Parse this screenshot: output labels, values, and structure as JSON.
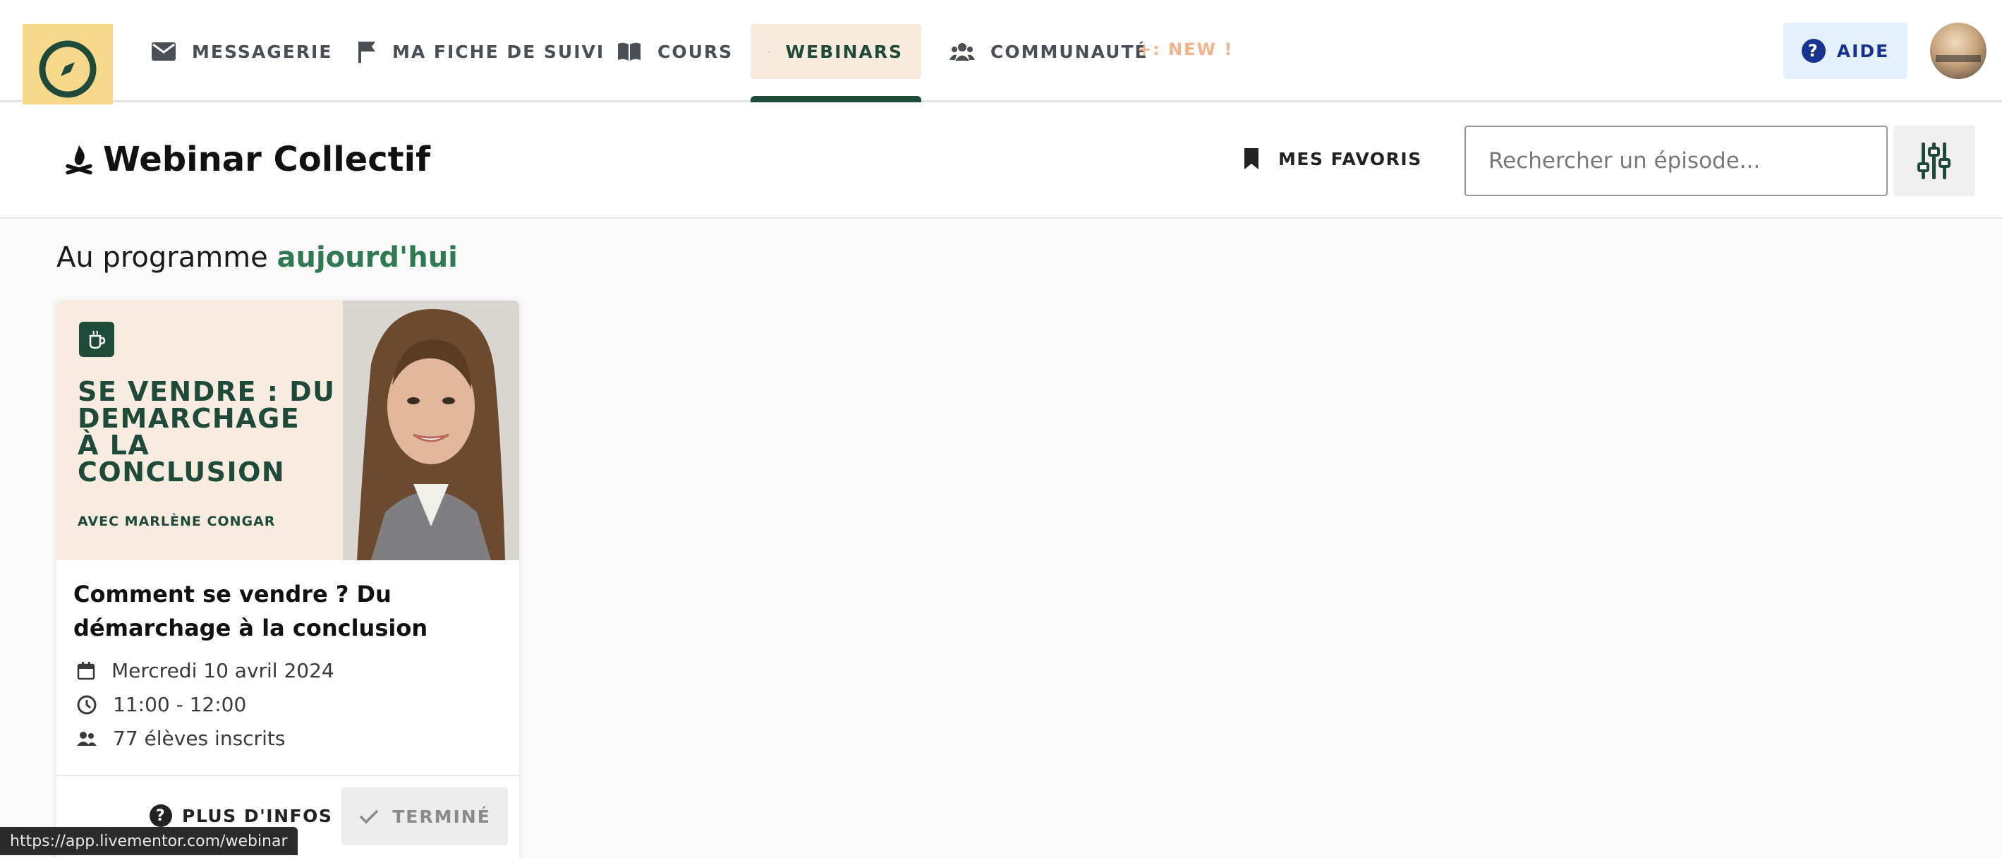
{
  "nav": {
    "items": [
      {
        "label": "MESSAGERIE",
        "icon": "envelope-icon"
      },
      {
        "label": "MA FICHE DE SUIVI",
        "icon": "flag-icon"
      },
      {
        "label": "COURS",
        "icon": "book-icon"
      },
      {
        "label": "WEBINARS",
        "icon": "campfire-icon",
        "active": true
      },
      {
        "label": "COMMUNAUTÉ",
        "icon": "people-icon"
      }
    ],
    "new_badge": "+: NEW !",
    "help_label": "AIDE",
    "help_icon": "?"
  },
  "subheader": {
    "title": "Webinar Collectif",
    "favorites_label": "MES FAVORIS",
    "search_placeholder": "Rechercher un épisode..."
  },
  "section": {
    "title_prefix": "Au programme",
    "title_accent": "aujourd'hui"
  },
  "card": {
    "thumb_title_lines": [
      "SE VENDRE : DU",
      "DEMARCHAGE",
      "À LA",
      "CONCLUSION"
    ],
    "thumb_subtitle": "AVEC MARLÈNE CONGAR",
    "title": "Comment se vendre ? Du démarchage à la conclusion",
    "date": "Mercredi 10 avril 2024",
    "time": "11:00 - 12:00",
    "attendees": "77 élèves inscrits",
    "more_info_label": "PLUS D'INFOS",
    "more_info_icon": "?",
    "done_label": "TERMINÉ"
  },
  "status_url": "https://app.livementor.com/webinar",
  "colors": {
    "brand_green": "#1f4a3a",
    "accent_green": "#2f7a53",
    "logo_yellow": "#f6d98b",
    "active_tab_bg": "#f7ebde",
    "help_blue": "#17338f"
  }
}
